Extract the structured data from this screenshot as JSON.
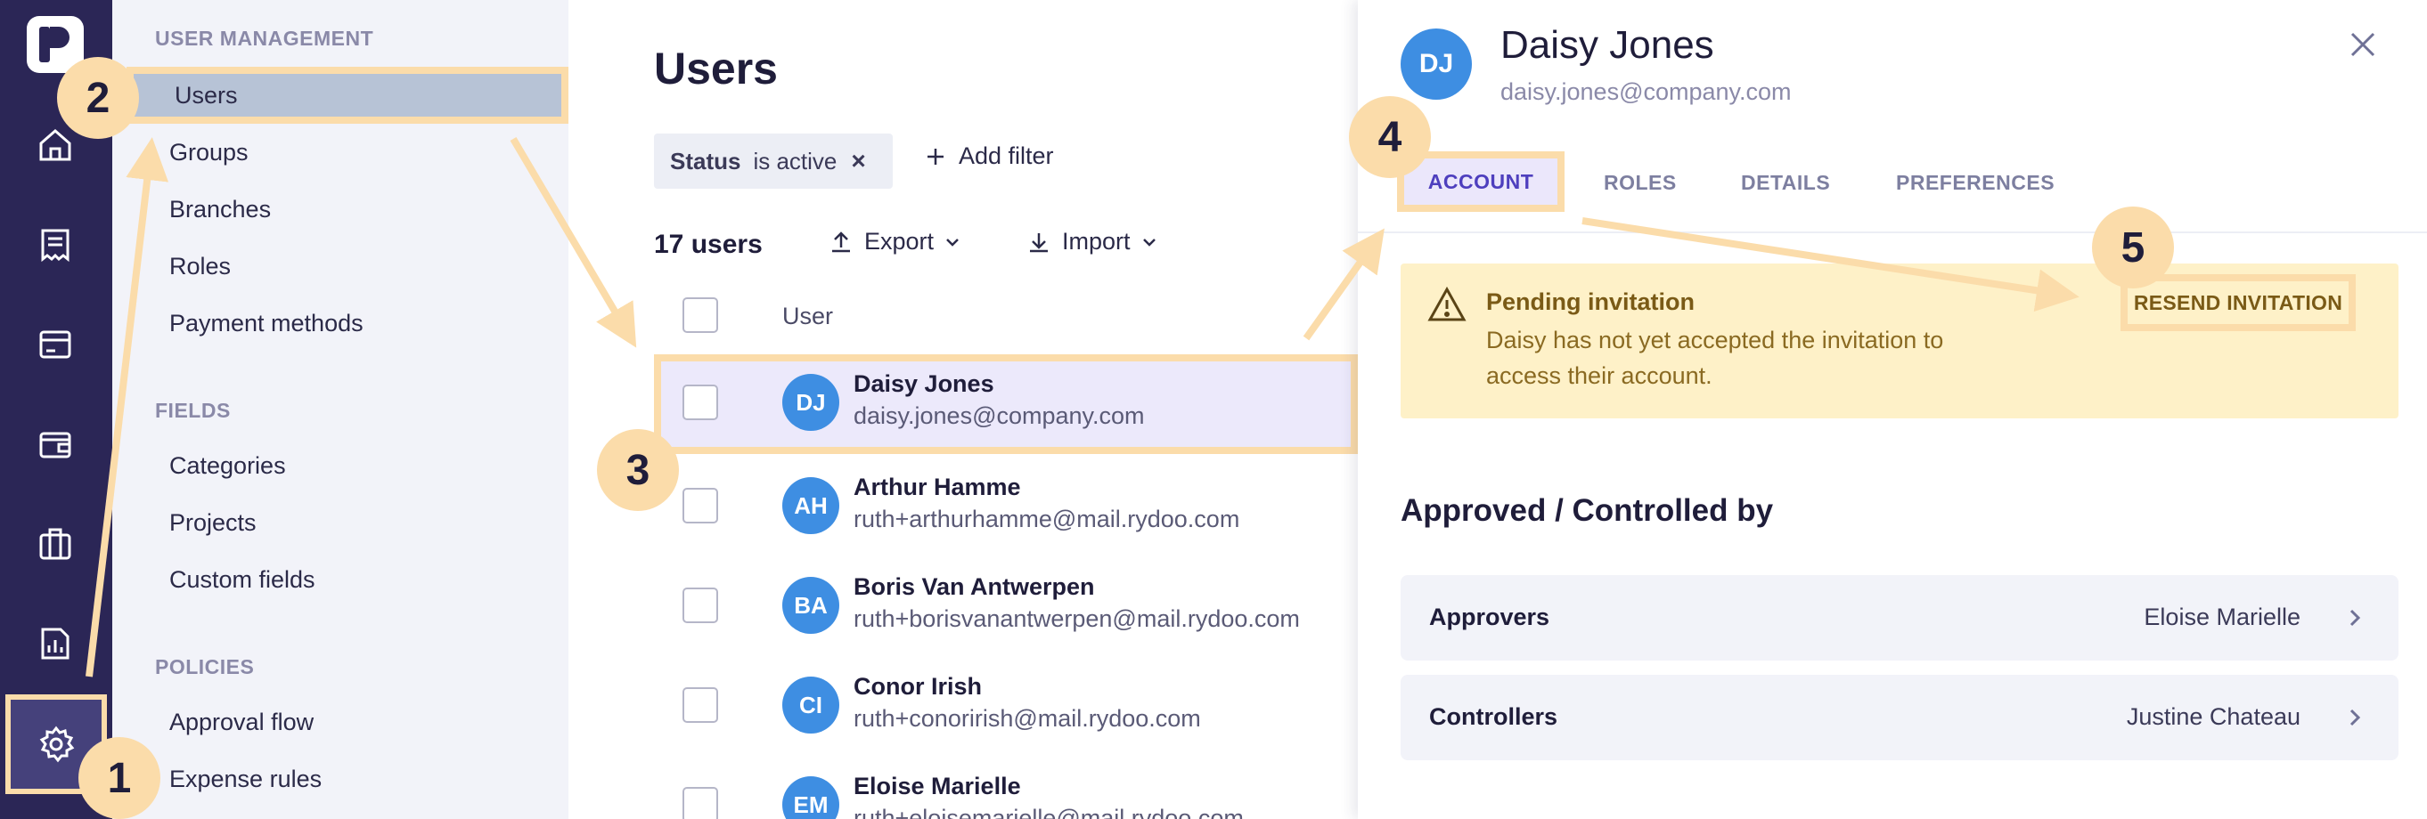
{
  "sidebar": {
    "groups": {
      "user_management": "USER MANAGEMENT",
      "fields": "FIELDS",
      "policies": "POLICIES"
    },
    "items": {
      "users": "Users",
      "groups": "Groups",
      "branches": "Branches",
      "roles": "Roles",
      "payment_methods": "Payment methods",
      "categories": "Categories",
      "projects": "Projects",
      "custom_fields": "Custom fields",
      "approval_flow": "Approval flow",
      "expense_rules": "Expense rules"
    }
  },
  "list": {
    "title": "Users",
    "filter": {
      "key": "Status",
      "value": "is active",
      "remove": "×"
    },
    "add_filter": "Add filter",
    "count": "17 users",
    "export": "Export",
    "import": "Import",
    "column_user": "User",
    "rows": [
      {
        "initials": "DJ",
        "name": "Daisy Jones",
        "email": "daisy.jones@company.com"
      },
      {
        "initials": "AH",
        "name": "Arthur Hamme",
        "email": "ruth+arthurhamme@mail.rydoo.com"
      },
      {
        "initials": "BA",
        "name": "Boris Van Antwerpen",
        "email": "ruth+borisvanantwerpen@mail.rydoo.com"
      },
      {
        "initials": "CI",
        "name": "Conor Irish",
        "email": "ruth+conorirish@mail.rydoo.com"
      },
      {
        "initials": "EM",
        "name": "Eloise Marielle",
        "email": "ruth+eloisemarielle@mail.rydoo.com"
      }
    ]
  },
  "panel": {
    "initials": "DJ",
    "name": "Daisy Jones",
    "email": "daisy.jones@company.com",
    "tabs": [
      "ACCOUNT",
      "ROLES",
      "DETAILS",
      "PREFERENCES"
    ],
    "alert": {
      "title": "Pending invitation",
      "message": "Daisy has not yet accepted the invitation to access their account.",
      "action": "RESEND INVITATION"
    },
    "section_title": "Approved / Controlled by",
    "approvers_label": "Approvers",
    "approvers_value": "Eloise Marielle",
    "controllers_label": "Controllers",
    "controllers_value": "Justine Chateau"
  },
  "steps": [
    "1",
    "2",
    "3",
    "4",
    "5"
  ],
  "colors": {
    "rail": "#2b2656",
    "highlight": "#fbdcaa",
    "avatar": "#3e8ee2",
    "selected_row": "#ece9fb",
    "alert_bg": "#fef1c8"
  },
  "icons": [
    "logo-icon",
    "home-icon",
    "receipt-icon",
    "card-icon",
    "wallet-icon",
    "briefcase-icon",
    "report-icon",
    "gear-icon",
    "close-icon",
    "warning-icon",
    "chevron-right-icon",
    "plus-icon",
    "upload-icon",
    "download-icon",
    "chevron-down-icon"
  ]
}
